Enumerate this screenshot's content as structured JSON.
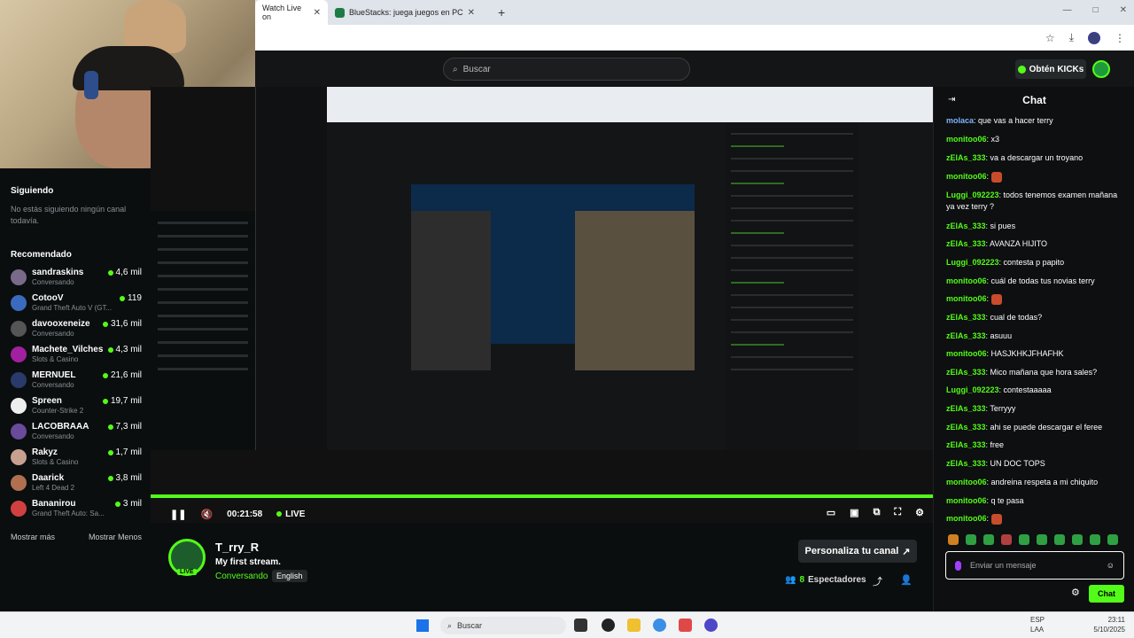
{
  "browser": {
    "tabs": [
      {
        "label": "Watch Live on",
        "active": true
      },
      {
        "label": "BlueStacks: juega juegos en PC",
        "active": false
      }
    ],
    "new_tab": "+",
    "window_controls": [
      "—",
      "□",
      "✕"
    ]
  },
  "header": {
    "search_placeholder": "Buscar",
    "kicks_button": "Obtén KICKs"
  },
  "sidebar": {
    "following_title": "Siguiendo",
    "following_empty": "No estás siguiendo ningún canal todavía.",
    "recommended_title": "Recomendado",
    "recommended": [
      {
        "name": "sandraskins",
        "category": "Conversando",
        "viewers": "4,6 mil"
      },
      {
        "name": "CotooV",
        "category": "Grand Theft Auto V (GT...",
        "viewers": "119"
      },
      {
        "name": "davooxeneize",
        "category": "Conversando",
        "viewers": "31,6 mil"
      },
      {
        "name": "Machete_Vilches",
        "category": "Slots & Casino",
        "viewers": "4,3 mil"
      },
      {
        "name": "MERNUEL",
        "category": "Conversando",
        "viewers": "21,6 mil"
      },
      {
        "name": "Spreen",
        "category": "Counter-Strike 2",
        "viewers": "19,7 mil"
      },
      {
        "name": "LACOBRAAA",
        "category": "Conversando",
        "viewers": "7,3 mil"
      },
      {
        "name": "Rakyz",
        "category": "Slots & Casino",
        "viewers": "1,7 mil"
      },
      {
        "name": "Daarick",
        "category": "Left 4 Dead 2",
        "viewers": "3,8 mil"
      },
      {
        "name": "Bananirou",
        "category": "Grand Theft Auto: Sa...",
        "viewers": "3 mil"
      }
    ],
    "show_more": "Mostrar más",
    "show_less": "Mostrar Menos"
  },
  "player": {
    "time": "00:21:58",
    "live_label": "LIVE"
  },
  "stream": {
    "channel": "T_rry_R",
    "title": "My first stream.",
    "category": "Conversando",
    "language": "English",
    "live_badge": "LIVE",
    "customize_button": "Personaliza tu canal",
    "viewers_count": "8",
    "viewers_label": "Espectadores"
  },
  "chat": {
    "title": "Chat",
    "messages": [
      {
        "user": "molaca",
        "text": "que vas a hacer terry",
        "color": "#7fb3ff"
      },
      {
        "user": "monitoo06",
        "text": "x3",
        "color": "#53fc18"
      },
      {
        "user": "zElAs_333",
        "text": "va a descargar un troyano",
        "color": "#53fc18"
      },
      {
        "user": "monitoo06",
        "text": "",
        "color": "#53fc18"
      },
      {
        "user": "Luggi_092223",
        "text": "todos tenemos examen mañana ya vez terry ?",
        "color": "#53fc18"
      },
      {
        "user": "zElAs_333",
        "text": "si pues",
        "color": "#53fc18"
      },
      {
        "user": "zElAs_333",
        "text": "AVANZA HIJITO",
        "color": "#53fc18"
      },
      {
        "user": "Luggi_092223",
        "text": "contesta p papito",
        "color": "#53fc18"
      },
      {
        "user": "monitoo06",
        "text": "cuál de todas tus novias terry",
        "color": "#53fc18"
      },
      {
        "user": "monitoo06",
        "text": "",
        "color": "#53fc18"
      },
      {
        "user": "zElAs_333",
        "text": "cual de todas?",
        "color": "#53fc18"
      },
      {
        "user": "zElAs_333",
        "text": "asuuu",
        "color": "#53fc18"
      },
      {
        "user": "monitoo06",
        "text": "HASJKHKJFHAFHK",
        "color": "#53fc18"
      },
      {
        "user": "zElAs_333",
        "text": "Mico mañana que hora sales?",
        "color": "#53fc18"
      },
      {
        "user": "Luggi_092223",
        "text": "contestaaaaa",
        "color": "#53fc18"
      },
      {
        "user": "zElAs_333",
        "text": "Terryyy",
        "color": "#53fc18"
      },
      {
        "user": "zElAs_333",
        "text": "ahi se puede descargar el feree",
        "color": "#53fc18"
      },
      {
        "user": "zElAs_333",
        "text": "free",
        "color": "#53fc18"
      },
      {
        "user": "zElAs_333",
        "text": "UN DOC TOPS",
        "color": "#53fc18"
      },
      {
        "user": "monitoo06",
        "text": "andreina respeta a mi chiquito",
        "color": "#53fc18"
      },
      {
        "user": "monitoo06",
        "text": "q te pasa",
        "color": "#53fc18"
      },
      {
        "user": "monitoo06",
        "text": "",
        "color": "#53fc18"
      }
    ],
    "input_placeholder": "Enviar un mensaje",
    "send_button": "Chat"
  },
  "taskbar": {
    "search_placeholder": "Buscar",
    "lang_line1": "ESP",
    "lang_line2": "LAA",
    "time": "23:11",
    "date": "5/10/2025"
  },
  "colors": {
    "accent": "#53fc18",
    "bg": "#0b0e0f"
  }
}
